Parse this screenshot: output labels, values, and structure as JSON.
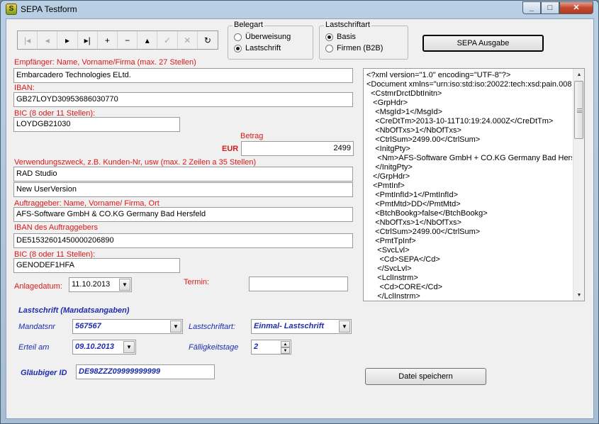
{
  "window": {
    "title": "SEPA Testform",
    "icon": "app-icon",
    "buttons": {
      "minimize": "minimize-icon",
      "maximize": "maximize-icon",
      "close": "close-icon"
    }
  },
  "navigator": {
    "buttons": [
      {
        "name": "first",
        "glyph": "|◂",
        "enabled": false
      },
      {
        "name": "prior",
        "glyph": "◂",
        "enabled": false
      },
      {
        "name": "next",
        "glyph": "▸",
        "enabled": true
      },
      {
        "name": "last",
        "glyph": "▸|",
        "enabled": true
      },
      {
        "name": "insert",
        "glyph": "+",
        "enabled": true
      },
      {
        "name": "delete",
        "glyph": "−",
        "enabled": true
      },
      {
        "name": "edit",
        "glyph": "▴",
        "enabled": true
      },
      {
        "name": "post",
        "glyph": "✓",
        "enabled": false
      },
      {
        "name": "cancel",
        "glyph": "✕",
        "enabled": false
      },
      {
        "name": "refresh",
        "glyph": "↻",
        "enabled": true
      }
    ]
  },
  "belegart": {
    "legend": "Belegart",
    "options": [
      {
        "label": "Überweisung",
        "selected": false
      },
      {
        "label": "Lastschrift",
        "selected": true
      }
    ]
  },
  "lastschriftart_group": {
    "legend": "Lastschriftart",
    "options": [
      {
        "label": "Basis",
        "selected": true
      },
      {
        "label": "Firmen (B2B)",
        "selected": false
      }
    ]
  },
  "buttons": {
    "sepa_ausgabe": "SEPA Ausgabe",
    "datei_speichern": "Datei speichern"
  },
  "form": {
    "empfaenger_label": "Empfänger: Name, Vorname/Firma (max. 27 Stellen)",
    "empfaenger_value": "Embarcadero Technologies ELtd.",
    "iban_label": "IBAN:",
    "iban_value": "GB27LOYD30953686030770",
    "bic_label": "BIC (8 oder 11 Stellen):",
    "bic_value": "LOYDGB21030",
    "betrag_label": "Betrag",
    "currency": "EUR",
    "betrag_value": "2499",
    "verwendungszweck_label": "Verwendungszweck, z.B. Kunden-Nr, usw (max. 2 Zeilen a 35 Stellen)",
    "verwendungszweck_1": "RAD Studio",
    "verwendungszweck_2": "New UserVersion",
    "auftraggeber_label": "Auftraggeber: Name, Vorname/ Firma, Ort",
    "auftraggeber_value": "AFS-Software GmbH & CO.KG Germany Bad Hersfeld",
    "iban_auftraggeber_label": "IBAN des Auftraggebers",
    "iban_auftraggeber_value": "DE51532601450000206890",
    "bic_auftraggeber_label": "BIC (8 oder 11 Stellen):",
    "bic_auftraggeber_value": "GENODEF1HFA",
    "anlagedatum_label": "Anlagedatum:",
    "anlagedatum_value": "11.10.2013",
    "termin_label": "Termin:",
    "termin_value": ""
  },
  "mandat": {
    "header": "Lastschrift (Mandatsangaben)",
    "mandatsnr_label": "Mandatsnr",
    "mandatsnr_value": "567567",
    "lastschriftart_label": "Lastschriftart:",
    "lastschriftart_value": "Einmal- Lastschrift",
    "erteil_label": "Erteil am",
    "erteil_value": "09.10.2013",
    "faelligkeitstage_label": "Fälligkeitstage",
    "faelligkeitstage_value": "2",
    "glaeubiger_label": "Gläubiger ID",
    "glaeubiger_value": "DE98ZZZ09999999999"
  },
  "xml_memo": {
    "lines": [
      "<?xml version=\"1.0\" encoding=\"UTF-8\"?>",
      "<Document xmlns=\"urn:iso:std:iso:20022:tech:xsd:pain.008",
      "  <CstmrDrctDbtInitn>",
      "   <GrpHdr>",
      "    <MsgId>1</MsgId>",
      "    <CreDtTm>2013-10-11T10:19:24.000Z</CreDtTm>",
      "    <NbOfTxs>1</NbOfTxs>",
      "    <CtrlSum>2499.00</CtrlSum>",
      "    <InitgPty>",
      "     <Nm>AFS-Software GmbH + CO.KG Germany Bad Hersfe",
      "    </InitgPty>",
      "   </GrpHdr>",
      "   <PmtInf>",
      "    <PmtInfId>1</PmtInfId>",
      "    <PmtMtd>DD</PmtMtd>",
      "    <BtchBookg>false</BtchBookg>",
      "    <NbOfTxs>1</NbOfTxs>",
      "    <CtrlSum>2499.00</CtrlSum>",
      "    <PmtTpInf>",
      "     <SvcLvl>",
      "      <Cd>SEPA</Cd>",
      "     </SvcLvl>",
      "     <LclInstrm>",
      "      <Cd>CORE</Cd>",
      "     </LclInstrm>"
    ]
  }
}
